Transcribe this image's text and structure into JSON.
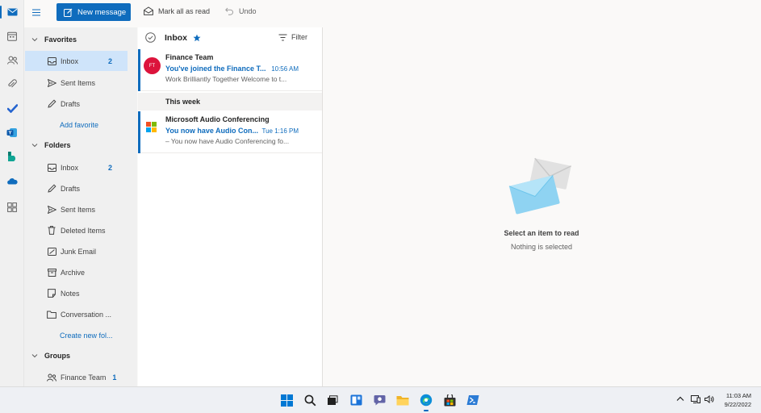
{
  "rail": {
    "items": [
      {
        "name": "mail-icon",
        "active": true
      },
      {
        "name": "calendar-icon",
        "active": false
      },
      {
        "name": "people-icon",
        "active": false
      },
      {
        "name": "attachment-icon",
        "active": false
      },
      {
        "name": "todo-icon",
        "active": false
      },
      {
        "name": "yammer-icon",
        "active": false
      },
      {
        "name": "bookings-icon",
        "active": false
      },
      {
        "name": "onedrive-icon",
        "active": false
      },
      {
        "name": "apps-icon",
        "active": false
      }
    ]
  },
  "toolbar": {
    "new_message": "New message",
    "mark_all_read": "Mark all as read",
    "undo": "Undo"
  },
  "folders": {
    "favorites_label": "Favorites",
    "favorites": [
      {
        "label": "Inbox",
        "count": "2",
        "icon": "inbox-icon",
        "selected": true
      },
      {
        "label": "Sent Items",
        "count": "",
        "icon": "send-icon"
      },
      {
        "label": "Drafts",
        "count": "",
        "icon": "pencil-icon"
      }
    ],
    "add_favorite": "Add favorite",
    "folders_label": "Folders",
    "folders": [
      {
        "label": "Inbox",
        "count": "2",
        "icon": "inbox-icon"
      },
      {
        "label": "Drafts",
        "count": "",
        "icon": "pencil-icon"
      },
      {
        "label": "Sent Items",
        "count": "",
        "icon": "send-icon"
      },
      {
        "label": "Deleted Items",
        "count": "",
        "icon": "trash-icon"
      },
      {
        "label": "Junk Email",
        "count": "",
        "icon": "junk-icon"
      },
      {
        "label": "Archive",
        "count": "",
        "icon": "archive-icon"
      },
      {
        "label": "Notes",
        "count": "",
        "icon": "note-icon"
      },
      {
        "label": "Conversation ...",
        "count": "",
        "icon": "folder-icon"
      }
    ],
    "create_folder": "Create new fol...",
    "groups_label": "Groups",
    "groups": [
      {
        "label": "Finance Team",
        "count": "1",
        "icon": "group-icon"
      }
    ]
  },
  "list": {
    "title": "Inbox",
    "filter": "Filter",
    "week_header": "This week",
    "messages": [
      {
        "avatar": "FT",
        "sender": "Finance Team",
        "subject": "You've joined the Finance T...",
        "time": "10:56 AM",
        "preview": "Work Brilliantly Together Welcome to t..."
      },
      {
        "avatar": "",
        "sender": "Microsoft Audio Conferencing",
        "subject": "You now have Audio Con...",
        "time": "Tue 1:16 PM",
        "preview": "– You now have Audio Conferencing fo..."
      }
    ]
  },
  "reading": {
    "title": "Select an item to read",
    "subtitle": "Nothing is selected"
  },
  "taskbar": {
    "time": "11:03 AM",
    "date": "9/22/2022"
  },
  "colors": {
    "accent": "#0f6cbd",
    "selected_bg": "#cfe4fa",
    "avatar_bg": "#dc143c"
  }
}
